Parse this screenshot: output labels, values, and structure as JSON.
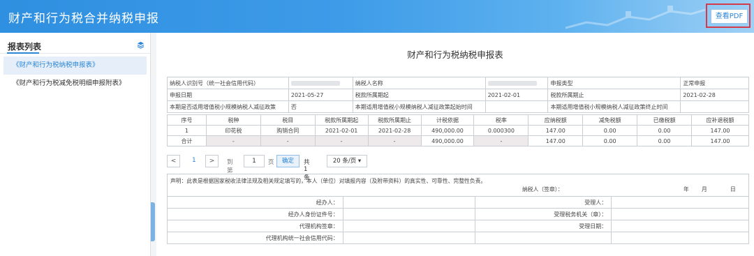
{
  "header": {
    "title": "财产和行为税合并纳税申报",
    "pdf_button": "查看PDF"
  },
  "sidebar": {
    "title": "报表列表",
    "items": [
      {
        "label": "《财产和行为税纳税申报表》"
      },
      {
        "label": "《财产和行为税减免税明细申报附表》"
      }
    ]
  },
  "doc": {
    "title": "财产和行为税纳税申报表"
  },
  "info": {
    "taxpayer_id_label": "纳税人识别号（统一社会信用代码）",
    "taxpayer_name_label": "纳税人名称",
    "declare_type_label": "申报类型",
    "declare_type_value": "正常申报",
    "declare_date_label": "申报日期",
    "declare_date_value": "2021-05-27",
    "period_start_label": "税款所属期起",
    "period_start_value": "2021-02-01",
    "period_end_label": "税款所属期止",
    "period_end_value": "2021-02-28",
    "policy_label": "本期是否适用增值税小规模纳税人减征政策",
    "policy_value": "否",
    "policy_start_label": "本期适用增值税小规模纳税人减征政策起始时间",
    "policy_end_label": "本期适用增值税小规模纳税人减征政策终止时间"
  },
  "tax_table": {
    "headers": [
      "序号",
      "税种",
      "税目",
      "税款所属期起",
      "税款所属期止",
      "计税依据",
      "税率",
      "应纳税额",
      "减免税额",
      "已缴税额",
      "应补退税额"
    ],
    "rows": [
      [
        "1",
        "印花税",
        "购销合同",
        "2021-02-01",
        "2021-02-28",
        "490,000.00",
        "0.000300",
        "147.00",
        "0.00",
        "0.00",
        "147.00"
      ]
    ],
    "total": [
      "合计",
      "-",
      "-",
      "-",
      "-",
      "490,000.00",
      "-",
      "147.00",
      "0.00",
      "0.00",
      "147.00"
    ]
  },
  "pager": {
    "prev": "<",
    "current_page": "1",
    "next": ">",
    "goto_label": "到第",
    "page_input": "1",
    "page_unit": "页",
    "confirm": "确定",
    "total": "共 1 条",
    "page_size": "20 条/页"
  },
  "declaration": {
    "statement": "声明：此表是根据国家税收法律法规及相关规定填写的，本人（单位）对填报内容（及附带资料）的真实性、可靠性、完整性负责。",
    "taxpayer_sign": "纳税人（签章）：",
    "year": "年",
    "month": "月",
    "day": "日"
  },
  "sign_table": {
    "agent": "经办人：",
    "agent_id": "经办人身份证件号：",
    "agency_seal": "代理机构签章：",
    "agency_code": "代理机构统一社会信用代码：",
    "receiver": "受理人：",
    "tax_office": "受理税务机关（章）：",
    "receive_date": "受理日期："
  }
}
